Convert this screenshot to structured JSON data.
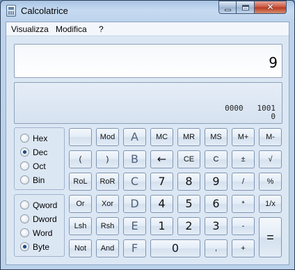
{
  "window": {
    "title": "Calcolatrice"
  },
  "menu": [
    "Visualizza",
    "Modifica",
    "?"
  ],
  "display": {
    "value": "9",
    "bits_line1": "0000   1001",
    "bits_line2": "0"
  },
  "base_options": [
    {
      "label": "Hex",
      "checked": false
    },
    {
      "label": "Dec",
      "checked": true
    },
    {
      "label": "Oct",
      "checked": false
    },
    {
      "label": "Bin",
      "checked": false
    }
  ],
  "word_options": [
    {
      "label": "Qword",
      "checked": false
    },
    {
      "label": "Dword",
      "checked": false
    },
    {
      "label": "Word",
      "checked": false
    },
    {
      "label": "Byte",
      "checked": true
    }
  ],
  "keys": {
    "r1": [
      "",
      "Mod",
      "A",
      "MC",
      "MR",
      "MS",
      "M+",
      "M-"
    ],
    "r2": [
      "(",
      ")",
      "B",
      "←",
      "CE",
      "C",
      "±",
      "√"
    ],
    "r3": [
      "RoL",
      "RoR",
      "C",
      "7",
      "8",
      "9",
      "/",
      "%"
    ],
    "r4": [
      "Or",
      "Xor",
      "D",
      "4",
      "5",
      "6",
      "*",
      "1/x"
    ],
    "r5": [
      "Lsh",
      "Rsh",
      "E",
      "1",
      "2",
      "3",
      "-",
      "="
    ],
    "r6": [
      "Not",
      "And",
      "F",
      "0",
      ",",
      "+"
    ]
  }
}
